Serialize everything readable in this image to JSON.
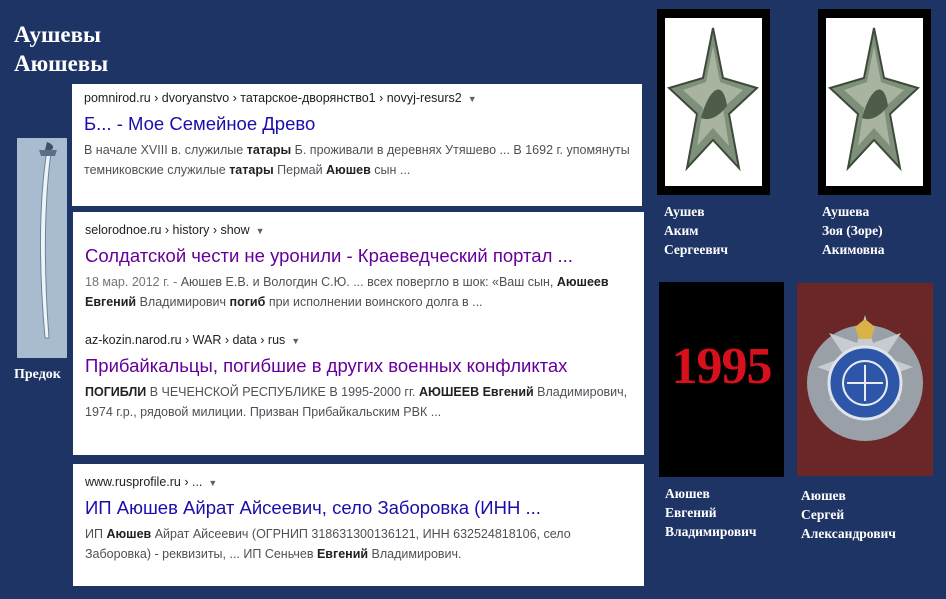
{
  "page": {
    "title_line1": "Аушевы",
    "title_line2": "Аюшевы",
    "ancestor_label": "Предок"
  },
  "results": [
    {
      "crumb": "pomnirod.ru › dvoryanstvo › татарское-дворянство1 › novyj-resurs2",
      "title": "Б... - Мое Семейное Древо",
      "snippet": [
        {
          "t": "В начале XVIII в. служилые "
        },
        {
          "t": "татары",
          "b": true
        },
        {
          "t": " Б. проживали в деревнях Утяшево ... В 1692 г. упомянуты темниковские служилые "
        },
        {
          "t": "татары",
          "b": true
        },
        {
          "t": " Пермай "
        },
        {
          "t": "Аюшев",
          "b": true
        },
        {
          "t": " сын ..."
        }
      ]
    },
    {
      "crumb": "selorodnoe.ru › history › show",
      "title": "Солдатской чести не уронили - Краеведческий портал ...",
      "snippet": [
        {
          "t": "18 мар. 2012 г. - ",
          "d": true
        },
        {
          "t": "Аюшев Е.В. и Вологдин С.Ю. ... всех повергло в шок: «Ваш сын, "
        },
        {
          "t": "Аюшеев Евгений",
          "b": true
        },
        {
          "t": " Владимирович "
        },
        {
          "t": "погиб",
          "b": true
        },
        {
          "t": " при исполнении воинского долга в ..."
        }
      ]
    },
    {
      "crumb": "az-kozin.narod.ru › WAR › data › rus",
      "title": "Прибайкальцы, погибшие в других военных конфликтах",
      "snippet": [
        {
          "t": "ПОГИБЛИ",
          "b": true
        },
        {
          "t": " В ЧЕЧЕНСКОЙ РЕСПУБЛИКЕ В 1995-2000 гг. "
        },
        {
          "t": "АЮШЕЕВ Евгений",
          "b": true
        },
        {
          "t": " Владимирович, 1974 г.р., рядовой милиции. Призван Прибайкальским РВК ..."
        }
      ]
    },
    {
      "crumb": "www.rusprofile.ru › ...",
      "title": "ИП Аюшев Айрат Айсеевич, село Заборовка (ИНН ...",
      "snippet": [
        {
          "t": "ИП "
        },
        {
          "t": "Аюшев",
          "b": true
        },
        {
          "t": " Айрат Айсеевич (ОГРНИП 318631300136121, ИНН 632524818106, село Заборовка) - реквизиты, ... ИП Сеньчев "
        },
        {
          "t": "Евгений",
          "b": true
        },
        {
          "t": " Владимирович."
        }
      ]
    }
  ],
  "people": [
    {
      "line1": "Аушев",
      "line2": "Аким",
      "line3": "Сергеевич"
    },
    {
      "line1": "Аушева",
      "line2": "Зоя (Зоре)",
      "line3": "Акимовна"
    },
    {
      "line1": "Аюшев",
      "line2": "Евгений",
      "line3": "Владимирович"
    },
    {
      "line1": "Аюшев",
      "line2": "Сергей",
      "line3": "Александрович"
    }
  ],
  "year_photo_text": "1995",
  "colors": {
    "background": "#1e3464",
    "link_blue": "#1a0dab",
    "link_visited": "#660099",
    "year_red": "#d8101c"
  },
  "icons": [
    "saber-icon",
    "soviet-star-badge-icon",
    "military-badge-icon",
    "caret-down-icon"
  ]
}
